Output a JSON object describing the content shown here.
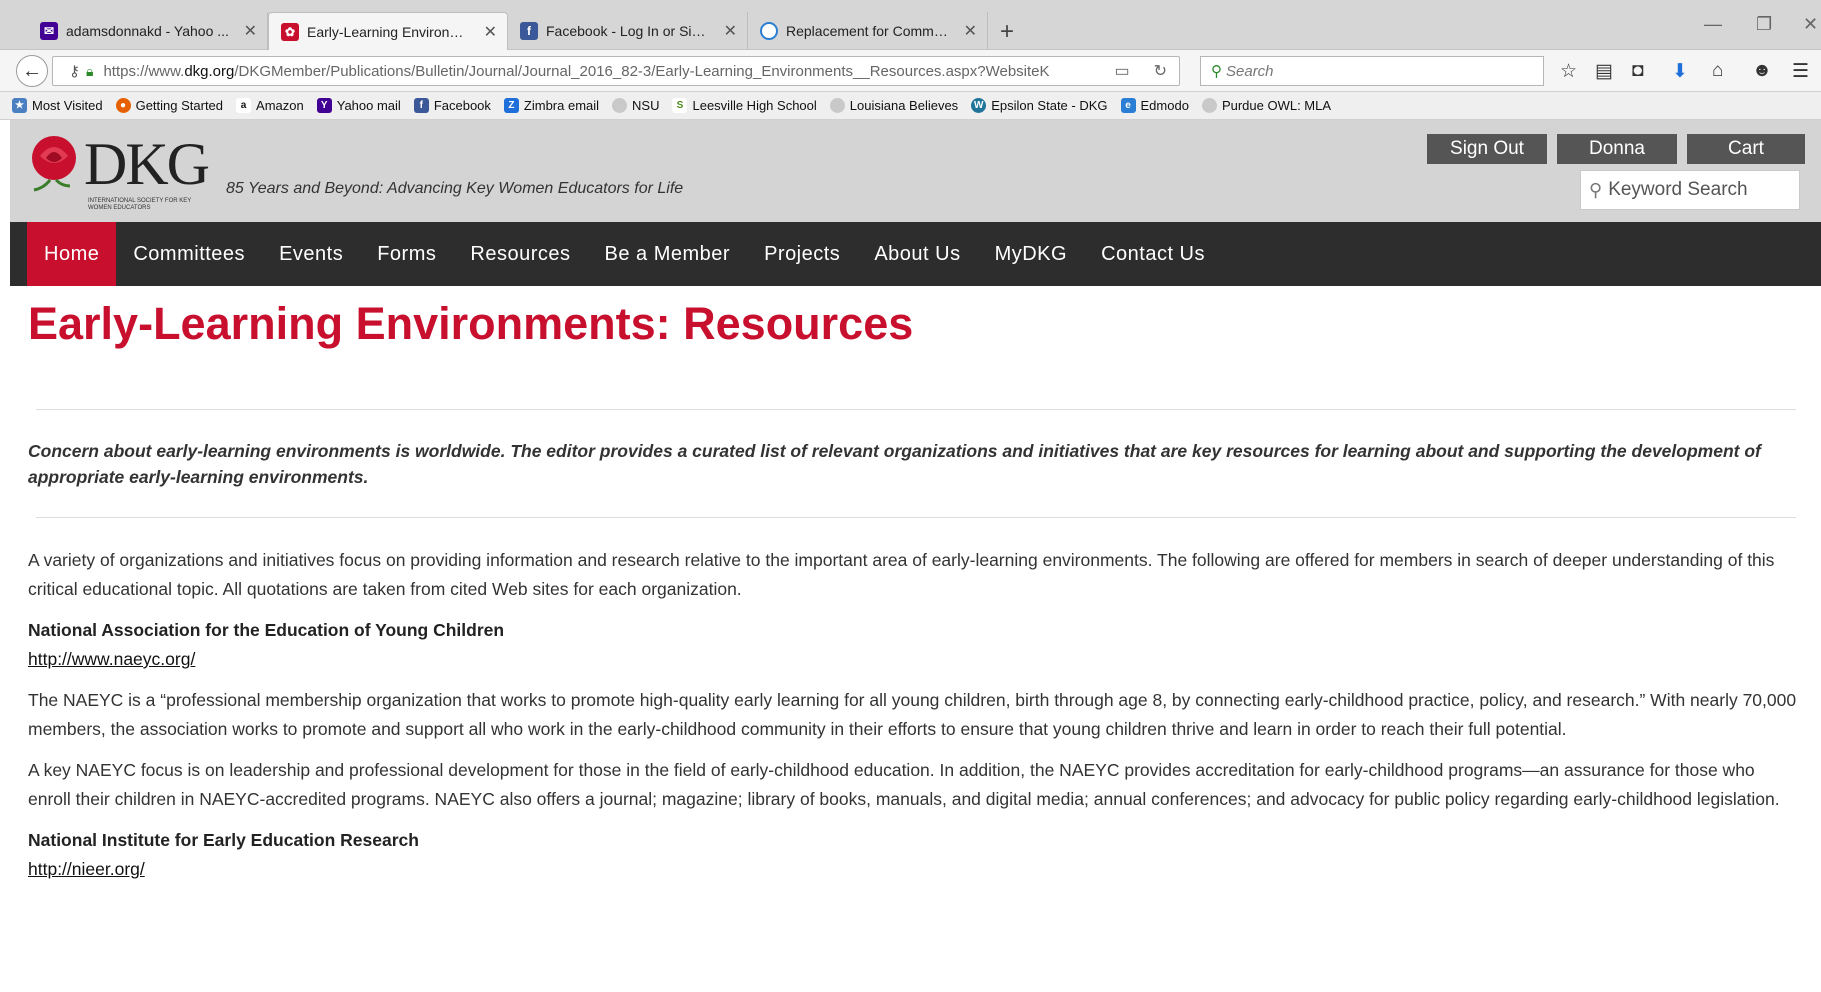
{
  "browser": {
    "tabs": [
      {
        "label": "adamsdonnakd - Yahoo ...",
        "icon": "mail-icon",
        "color": "#410093"
      },
      {
        "label": "Early-Learning Environme...",
        "icon": "dkg-rose-icon",
        "color": "#c8102e"
      },
      {
        "label": "Facebook - Log In or Sign ...",
        "icon": "facebook-icon",
        "color": "#3b5998"
      },
      {
        "label": "Replacement for Commo...",
        "icon": "loading-icon",
        "color": "#2a7fd4"
      }
    ],
    "url_prefix": "https://www.",
    "url_domain": "dkg.org",
    "url_path": "/DKGMember/Publications/Bulletin/Journal/Journal_2016_82-3/Early-Learning_Environments__Resources.aspx?WebsiteK",
    "search_placeholder": "Search",
    "bookmarks": [
      {
        "label": "Most Visited",
        "color": "#4a7fc1",
        "glyph": "★"
      },
      {
        "label": "Getting Started",
        "color": "#e66000",
        "glyph": "●"
      },
      {
        "label": "Amazon",
        "color": "#111111",
        "glyph": "a"
      },
      {
        "label": "Yahoo mail",
        "color": "#410093",
        "glyph": "Y"
      },
      {
        "label": "Facebook",
        "color": "#3b5998",
        "glyph": "f"
      },
      {
        "label": "Zimbra email",
        "color": "#1e6fd9",
        "glyph": "Z"
      },
      {
        "label": "NSU",
        "color": "#aaaaaa",
        "glyph": "○"
      },
      {
        "label": "Leesville High School",
        "color": "#4c8a1c",
        "glyph": "S"
      },
      {
        "label": "Louisiana Believes",
        "color": "#aaaaaa",
        "glyph": "○"
      },
      {
        "label": "Epsilon State - DKG",
        "color": "#21759b",
        "glyph": "W"
      },
      {
        "label": "Edmodo",
        "color": "#2a7fd4",
        "glyph": "e"
      },
      {
        "label": "Purdue OWL: MLA",
        "color": "#aaaaaa",
        "glyph": "○"
      }
    ]
  },
  "site": {
    "logo_text": "DKG",
    "logo_subtext": "INTERNATIONAL SOCIETY FOR KEY WOMEN EDUCATORS",
    "tagline": "85 Years and Beyond: Advancing Key Women Educators for Life",
    "sign_out": "Sign Out",
    "user": "Donna",
    "cart": "Cart",
    "keyword_search_placeholder": "Keyword Search",
    "nav": [
      "Home",
      "Committees",
      "Events",
      "Forms",
      "Resources",
      "Be a Member",
      "Projects",
      "About Us",
      "MyDKG",
      "Contact Us"
    ],
    "accent_color": "#c8102e"
  },
  "article": {
    "title": "Early-Learning Environments: Resources",
    "lede": "Concern about early-learning environments is worldwide. The editor provides a curated list of relevant organizations and initiatives that are key resources for learning about and supporting the development of appropriate early-learning environments.",
    "intro": "A variety of organizations and initiatives focus on providing information and research relative to the important area of early-learning environments. The following are offered for members in search of deeper understanding of this critical educational topic. All quotations are taken from cited Web sites for each organization.",
    "org1_name": "National Association for the Education of Young Children",
    "org1_link": "http://www.naeyc.org/",
    "org1_p1": "The NAEYC is a “professional membership organization that works to promote high-quality early learning for all young children, birth through age 8, by connecting early-childhood practice, policy, and research.” With nearly 70,000 members, the association works to promote and support all who work in the early-childhood community in their efforts to ensure that young children thrive and learn in order to reach their full potential.",
    "org1_p2": "A key NAEYC focus is on leadership and professional development for those in the field of early-childhood education. In addition, the NAEYC provides accreditation for early-childhood programs—an assurance for those who enroll their children in NAEYC-accredited programs. NAEYC also offers a journal; magazine; library of books, manuals, and digital media; annual conferences; and advocacy for public policy regarding early-childhood legislation.",
    "org2_name": "National Institute for Early Education Research",
    "org2_link": "http://nieer.org/"
  }
}
